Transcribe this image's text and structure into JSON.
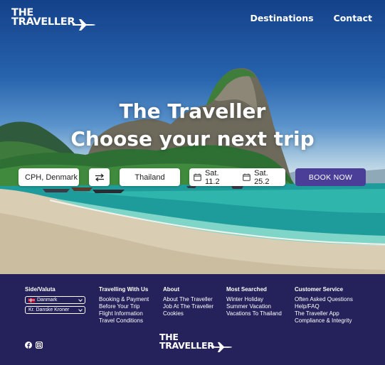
{
  "brand": {
    "line1": "THE",
    "line2": "TRAVELLER"
  },
  "nav": {
    "destinations": "Destinations",
    "contact": "Contact"
  },
  "hero": {
    "title": "The Traveller",
    "subtitle": "Choose your next trip"
  },
  "search": {
    "origin": "CPH, Denmark",
    "destination": "Thailand",
    "date_from": "Sat. 11.2",
    "date_to": "Sat. 25.2",
    "book_label": "BOOK NOW"
  },
  "footer": {
    "side_valuta": {
      "heading": "Side/Valuta",
      "country": "Danmark",
      "currency": "Kr. Danske Kroner"
    },
    "travelling": {
      "heading": "Travelling With Us",
      "links": [
        "Booking & Payment",
        "Before Your Trip",
        "Flight Information",
        "Travel Conditions"
      ]
    },
    "about": {
      "heading": "About",
      "links": [
        "About The Traveller",
        "Job At The Traveller",
        "Cookies"
      ]
    },
    "most_searched": {
      "heading": "Most Searched",
      "links": [
        "Winter Holiday",
        "Summer Vacation",
        "Vacations To Thailand"
      ]
    },
    "customer_service": {
      "heading": "Customer Service",
      "links": [
        "Often Asked Questions",
        "Help/FAQ",
        "The Traveller App",
        "Compliance & Integrity"
      ]
    }
  },
  "colors": {
    "accent": "#4a3e99",
    "footer_bg": "#25215b"
  },
  "icons": [
    "airplane-icon",
    "swap-arrows-icon",
    "calendar-icon",
    "facebook-icon",
    "instagram-icon",
    "chevron-down-icon"
  ]
}
